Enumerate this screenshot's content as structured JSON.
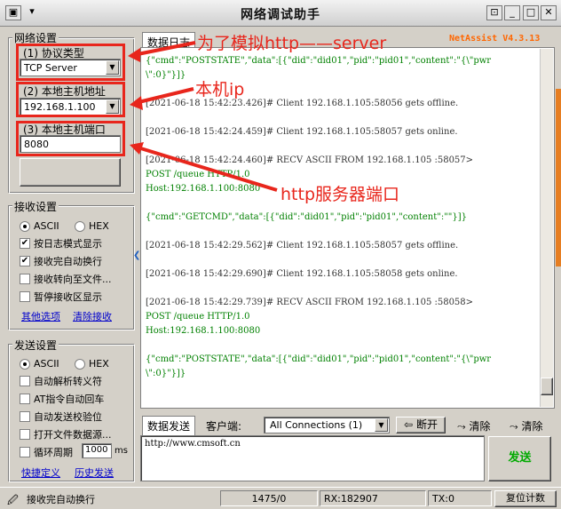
{
  "window": {
    "title": "网络调试助手",
    "brand": "NetAssist V4.3.13"
  },
  "network": {
    "group_label": "网络设置",
    "protocol_label": "(1) 协议类型",
    "protocol_value": "TCP Server",
    "host_label": "(2) 本地主机地址",
    "host_value": "192.168.1.100",
    "port_label": "(3) 本地主机端口",
    "port_value": "8080"
  },
  "receive": {
    "group_label": "接收设置",
    "ascii": "ASCII",
    "hex": "HEX",
    "opt_log": "按日志模式显示",
    "opt_autowrap": "接收完自动换行",
    "opt_tofile": "接收转向至文件...",
    "opt_pause": "暂停接收区显示",
    "link_other": "其他选项",
    "link_clear": "清除接收"
  },
  "send": {
    "group_label": "发送设置",
    "ascii": "ASCII",
    "hex": "HEX",
    "opt_escape": "自动解析转义符",
    "opt_at": "AT指令自动回车",
    "opt_checksum": "自动发送校验位",
    "opt_openfile": "打开文件数据源...",
    "opt_loop": "循环周期",
    "loop_value": "1000",
    "loop_unit": "ms",
    "link_shortcut": "快捷定义",
    "link_history": "历史发送"
  },
  "log_tab": "数据日志",
  "log_lines": [
    "{\"cmd\":\"POSTSTATE\",\"data\":[{\"did\":\"did01\",\"pid\":\"pid01\",\"content\":\"{\\\"pwr",
    "\\\":0}\"}]}",
    "[2021-06-18 15:42:23.426]# Client 192.168.1.105:58056 gets offline.",
    "[2021-06-18 15:42:24.459]# Client 192.168.1.105:58057 gets online.",
    "[2021-06-18 15:42:24.460]# RECV ASCII FROM 192.168.1.105 :58057>",
    "POST /queue HTTP/1.0",
    "Host:192.168.1.100:8080",
    "{\"cmd\":\"GETCMD\",\"data\":[{\"did\":\"did01\",\"pid\":\"pid01\",\"content\":\"\"}]}",
    "[2021-06-18 15:42:29.562]# Client 192.168.1.105:58057 gets offline.",
    "[2021-06-18 15:42:29.690]# Client 192.168.1.105:58058 gets online.",
    "[2021-06-18 15:42:29.739]# RECV ASCII FROM 192.168.1.105 :58058>",
    "POST /queue HTTP/1.0",
    "Host:192.168.1.100:8080",
    "{\"cmd\":\"POSTSTATE\",\"data\":[{\"did\":\"did01\",\"pid\":\"pid01\",\"content\":\"{\\\"pwr",
    "\\\":0}\"}]}"
  ],
  "send_area": {
    "tab": "数据发送",
    "client_label": "客户端:",
    "client_value": "All Connections (1)",
    "disconnect": "断开",
    "clear1": "清除",
    "clear2": "清除",
    "text": "http://www.cmsoft.cn",
    "send_button": "发送"
  },
  "annotations": {
    "a1": "为了模拟http——server",
    "a2": "本机ip",
    "a3": "http服务器端口"
  },
  "statusbar": {
    "message": "接收完自动换行",
    "counter": "1475/0",
    "rx": "RX:182907",
    "tx": "TX:0",
    "reset": "复位计数"
  },
  "colors": {
    "annotation": "#e8261c",
    "link": "#0000cc",
    "brand": "#ff6600",
    "send": "#00aa00"
  }
}
